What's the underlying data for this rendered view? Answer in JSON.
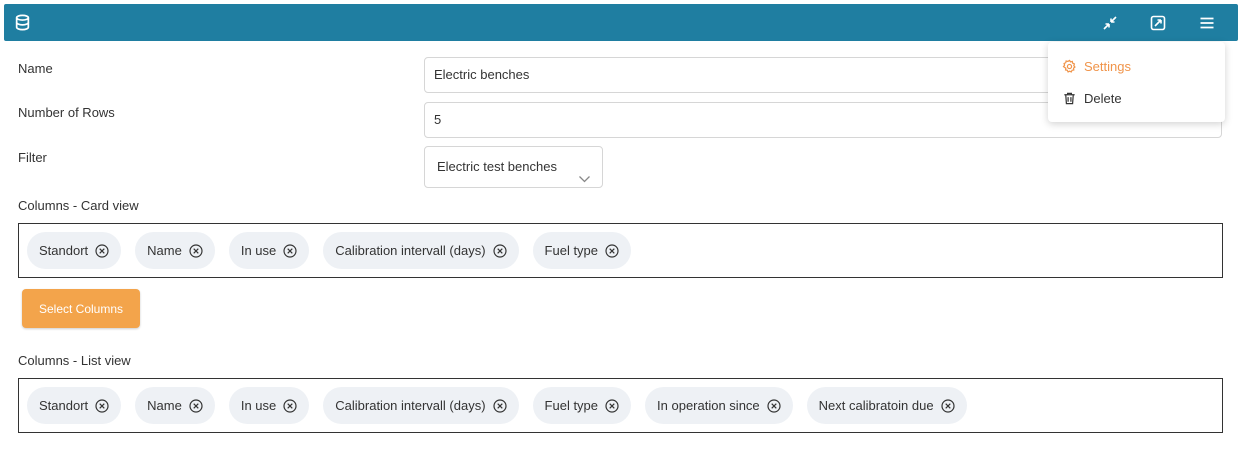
{
  "form": {
    "name_label": "Name",
    "name_value": "Electric benches",
    "rows_label": "Number of Rows",
    "rows_value": "5",
    "filter_label": "Filter",
    "filter_value": "Electric test benches",
    "card_view_label": "Columns - Card view",
    "card_columns": [
      "Standort",
      "Name",
      "In use",
      "Calibration intervall (days)",
      "Fuel type"
    ],
    "select_columns_label": "Select Columns",
    "list_view_label": "Columns - List view",
    "list_columns": [
      "Standort",
      "Name",
      "In use",
      "Calibration intervall (days)",
      "Fuel type",
      "In operation since",
      "Next calibratoin due"
    ]
  },
  "menu": {
    "settings_label": "Settings",
    "delete_label": "Delete"
  },
  "icons": {
    "header": [
      "database-icon",
      "collapse-icon",
      "expand-icon",
      "menu-icon"
    ],
    "menu": [
      "gear-icon",
      "trash-icon"
    ],
    "chip_remove": "circle-x-icon",
    "select": "chevron-down-icon"
  },
  "colors": {
    "header": "#1f7ea1",
    "accent": "#f3a44b",
    "settings_text": "#f0944a",
    "chip_bg": "#eef1f5"
  }
}
